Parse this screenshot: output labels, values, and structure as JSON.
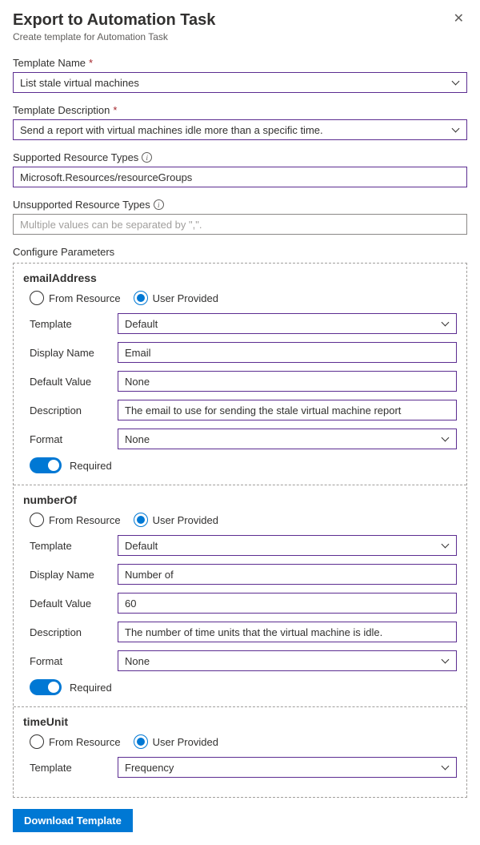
{
  "header": {
    "title": "Export to Automation Task",
    "subtitle": "Create template for Automation Task"
  },
  "labels": {
    "templateName": "Template Name",
    "templateDescription": "Template Description",
    "supportedTypes": "Supported Resource Types",
    "unsupportedTypes": "Unsupported Resource Types",
    "configureParams": "Configure Parameters",
    "fromResource": "From Resource",
    "userProvided": "User Provided",
    "template": "Template",
    "displayName": "Display Name",
    "defaultValue": "Default Value",
    "description": "Description",
    "format": "Format",
    "required": "Required",
    "download": "Download Template"
  },
  "values": {
    "templateName": "List stale virtual machines",
    "templateDescription": "Send a report with virtual machines idle more than a specific time.",
    "supportedTypes": "Microsoft.Resources/resourceGroups",
    "unsupportedPlaceholder": "Multiple values can be separated by \",\"."
  },
  "params": [
    {
      "name": "emailAddress",
      "source": "user",
      "template": "Default",
      "displayName": "Email",
      "defaultValue": "None",
      "description": "The email to use for sending the stale virtual machine report",
      "format": "None",
      "required": true,
      "showFull": true
    },
    {
      "name": "numberOf",
      "source": "user",
      "template": "Default",
      "displayName": "Number of",
      "defaultValue": "60",
      "description": "The number of time units that the virtual machine is idle.",
      "format": "None",
      "required": true,
      "showFull": true
    },
    {
      "name": "timeUnit",
      "source": "user",
      "template": "Frequency",
      "showFull": false
    }
  ]
}
